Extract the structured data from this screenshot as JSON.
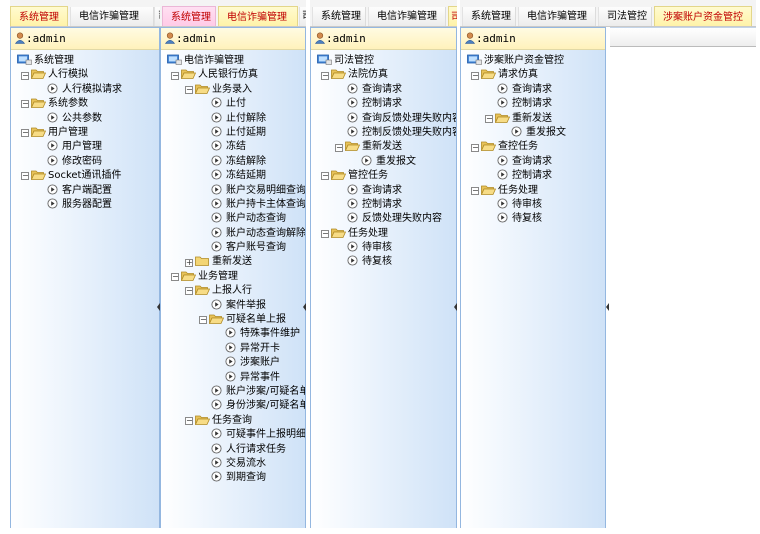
{
  "panels": [
    {
      "tabs": [
        {
          "label": "系统管理",
          "active": true
        },
        {
          "label": "电信诈骗管理",
          "active": false
        },
        {
          "label": "司",
          "active": false
        }
      ],
      "user": ":admin",
      "tree": [
        {
          "label": "系统管理",
          "level": 0,
          "type": "root"
        },
        {
          "label": "人行模拟",
          "level": 1,
          "type": "folder"
        },
        {
          "label": "人行模拟请求",
          "level": 2,
          "type": "leaf"
        },
        {
          "label": "系统参数",
          "level": 1,
          "type": "folder"
        },
        {
          "label": "公共参数",
          "level": 2,
          "type": "leaf"
        },
        {
          "label": "用户管理",
          "level": 1,
          "type": "folder"
        },
        {
          "label": "用户管理",
          "level": 2,
          "type": "leaf"
        },
        {
          "label": "修改密码",
          "level": 2,
          "type": "leaf"
        },
        {
          "label": "Socket通讯插件",
          "level": 1,
          "type": "folder"
        },
        {
          "label": "客户端配置",
          "level": 2,
          "type": "leaf"
        },
        {
          "label": "服务器配置",
          "level": 2,
          "type": "leaf"
        }
      ]
    },
    {
      "tabs": [
        {
          "label": "系统管理",
          "active": true
        },
        {
          "label": "电信诈骗管理",
          "active": true
        },
        {
          "label": "司",
          "active": false
        }
      ],
      "user": ":admin",
      "tree": [
        {
          "label": "电信诈骗管理",
          "level": 0,
          "type": "root"
        },
        {
          "label": "人民银行仿真",
          "level": 1,
          "type": "folder"
        },
        {
          "label": "业务录入",
          "level": 2,
          "type": "folder"
        },
        {
          "label": "止付",
          "level": 3,
          "type": "leaf"
        },
        {
          "label": "止付解除",
          "level": 3,
          "type": "leaf"
        },
        {
          "label": "止付延期",
          "level": 3,
          "type": "leaf"
        },
        {
          "label": "冻结",
          "level": 3,
          "type": "leaf"
        },
        {
          "label": "冻结解除",
          "level": 3,
          "type": "leaf"
        },
        {
          "label": "冻结延期",
          "level": 3,
          "type": "leaf"
        },
        {
          "label": "账户交易明细查询",
          "level": 3,
          "type": "leaf"
        },
        {
          "label": "账户持卡主体查询",
          "level": 3,
          "type": "leaf"
        },
        {
          "label": "账户动态查询",
          "level": 3,
          "type": "leaf"
        },
        {
          "label": "账户动态查询解除",
          "level": 3,
          "type": "leaf"
        },
        {
          "label": "客户账号查询",
          "level": 3,
          "type": "leaf"
        },
        {
          "label": "重新发送",
          "level": 2,
          "type": "folder",
          "collapsed": true
        },
        {
          "label": "业务管理",
          "level": 1,
          "type": "folder"
        },
        {
          "label": "上报人行",
          "level": 2,
          "type": "folder"
        },
        {
          "label": "案件举报",
          "level": 3,
          "type": "leaf"
        },
        {
          "label": "可疑名单上报",
          "level": 3,
          "type": "folder"
        },
        {
          "label": "特殊事件维护",
          "level": 4,
          "type": "leaf"
        },
        {
          "label": "异常开卡",
          "level": 4,
          "type": "leaf"
        },
        {
          "label": "涉案账户",
          "level": 4,
          "type": "leaf"
        },
        {
          "label": "异常事件",
          "level": 4,
          "type": "leaf"
        },
        {
          "label": "账户涉案/可疑名单",
          "level": 3,
          "type": "leaf"
        },
        {
          "label": "身份涉案/可疑名单",
          "level": 3,
          "type": "leaf"
        },
        {
          "label": "任务查询",
          "level": 2,
          "type": "folder"
        },
        {
          "label": "可疑事件上报明细",
          "level": 3,
          "type": "leaf"
        },
        {
          "label": "人行请求任务",
          "level": 3,
          "type": "leaf"
        },
        {
          "label": "交易流水",
          "level": 3,
          "type": "leaf"
        },
        {
          "label": "到期查询",
          "level": 3,
          "type": "leaf"
        }
      ]
    },
    {
      "tabs": [
        {
          "label": "系统管理",
          "active": false
        },
        {
          "label": "电信诈骗管理",
          "active": false
        },
        {
          "label": "司",
          "active": true
        }
      ],
      "user": ":admin",
      "tree": [
        {
          "label": "司法管控",
          "level": 0,
          "type": "root"
        },
        {
          "label": "法院仿真",
          "level": 1,
          "type": "folder"
        },
        {
          "label": "查询请求",
          "level": 2,
          "type": "leaf"
        },
        {
          "label": "控制请求",
          "level": 2,
          "type": "leaf"
        },
        {
          "label": "查询反馈处理失败内容",
          "level": 2,
          "type": "leaf"
        },
        {
          "label": "控制反馈处理失败内容",
          "level": 2,
          "type": "leaf"
        },
        {
          "label": "重新发送",
          "level": 2,
          "type": "folder"
        },
        {
          "label": "重发报文",
          "level": 3,
          "type": "leaf"
        },
        {
          "label": "管控任务",
          "level": 1,
          "type": "folder"
        },
        {
          "label": "查询请求",
          "level": 2,
          "type": "leaf"
        },
        {
          "label": "控制请求",
          "level": 2,
          "type": "leaf"
        },
        {
          "label": "反馈处理失败内容",
          "level": 2,
          "type": "leaf"
        },
        {
          "label": "任务处理",
          "level": 1,
          "type": "folder"
        },
        {
          "label": "待审核",
          "level": 2,
          "type": "leaf"
        },
        {
          "label": "待复核",
          "level": 2,
          "type": "leaf"
        }
      ]
    },
    {
      "tabs": [
        {
          "label": "系统管理",
          "active": false
        },
        {
          "label": "电信诈骗管理",
          "active": false
        },
        {
          "label": "司法管控",
          "active": false
        },
        {
          "label": "涉案账户资金管控",
          "active": true
        }
      ],
      "user": ":admin",
      "tree": [
        {
          "label": "涉案账户资金管控",
          "level": 0,
          "type": "root"
        },
        {
          "label": "请求仿真",
          "level": 1,
          "type": "folder"
        },
        {
          "label": "查询请求",
          "level": 2,
          "type": "leaf"
        },
        {
          "label": "控制请求",
          "level": 2,
          "type": "leaf"
        },
        {
          "label": "重新发送",
          "level": 2,
          "type": "folder"
        },
        {
          "label": "重发报文",
          "level": 3,
          "type": "leaf"
        },
        {
          "label": "查控任务",
          "level": 1,
          "type": "folder"
        },
        {
          "label": "查询请求",
          "level": 2,
          "type": "leaf"
        },
        {
          "label": "控制请求",
          "level": 2,
          "type": "leaf"
        },
        {
          "label": "任务处理",
          "level": 1,
          "type": "folder"
        },
        {
          "label": "待审核",
          "level": 2,
          "type": "leaf"
        },
        {
          "label": "待复核",
          "level": 2,
          "type": "leaf"
        }
      ]
    }
  ]
}
